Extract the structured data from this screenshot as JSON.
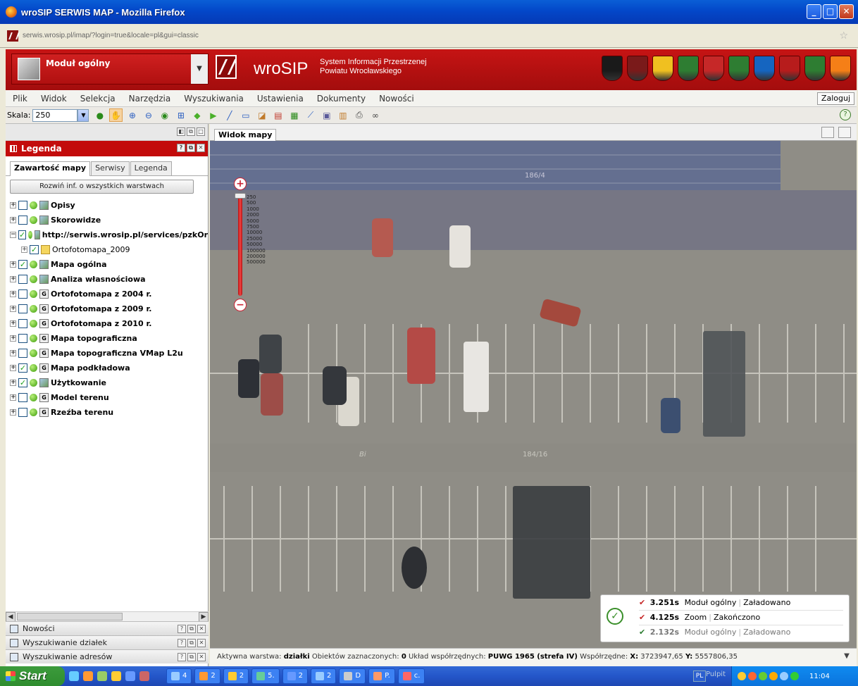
{
  "window": {
    "title": "wroSIP SERWIS MAP - Mozilla Firefox",
    "url": "serwis.wrosip.pl/imap/?login=true&locale=pl&gui=classic"
  },
  "header": {
    "module_label": "Moduł ogólny",
    "brand": "wroSIP",
    "brand_sub_1": "System Informacji Przestrzenej",
    "brand_sub_2": "Powiatu Wrocławskiego",
    "crest_colors": [
      "#1a1a1a",
      "#7a1a1a",
      "#f0c020",
      "#2e7d32",
      "#c62828",
      "#2e7d32",
      "#1565c0",
      "#b71c1c",
      "#2e7d32",
      "#f57f17"
    ]
  },
  "menu": {
    "items": [
      "Plik",
      "Widok",
      "Selekcja",
      "Narzędzia",
      "Wyszukiwania",
      "Ustawienia",
      "Dokumenty",
      "Nowości"
    ],
    "login": "Zaloguj"
  },
  "toolbar": {
    "scale_label": "Skala:",
    "scale_value": "250"
  },
  "legend": {
    "title": "Legenda",
    "tabs": [
      "Zawartość mapy",
      "Serwisy",
      "Legenda"
    ],
    "expand_button": "Rozwiń inf. o wszystkich warstwach",
    "layers": [
      {
        "name": "Opisy",
        "checked": false,
        "icon": "layer",
        "sub": false
      },
      {
        "name": "Skorowidze",
        "checked": false,
        "icon": "layer",
        "sub": false
      },
      {
        "name": "http://serwis.wrosip.pl/services/pzkOr",
        "checked": true,
        "icon": "wms",
        "sub": false
      },
      {
        "name": "Ortofotomapa_2009",
        "checked": true,
        "icon": "folder",
        "sub": true
      },
      {
        "name": "Mapa ogólna",
        "checked": true,
        "icon": "layer",
        "sub": false
      },
      {
        "name": "Analiza własnościowa",
        "checked": false,
        "icon": "layer",
        "sub": false
      },
      {
        "name": "Ortofotomapa z 2004 r.",
        "checked": false,
        "icon": "group",
        "sub": false
      },
      {
        "name": "Ortofotomapa z 2009 r.",
        "checked": false,
        "icon": "group",
        "sub": false
      },
      {
        "name": "Ortofotomapa z 2010 r.",
        "checked": false,
        "icon": "group",
        "sub": false
      },
      {
        "name": "Mapa topograficzna",
        "checked": false,
        "icon": "group",
        "sub": false
      },
      {
        "name": "Mapa topograficzna VMap L2u",
        "checked": false,
        "icon": "group",
        "sub": false
      },
      {
        "name": "Mapa podkładowa",
        "checked": true,
        "icon": "group",
        "sub": false
      },
      {
        "name": "Użytkowanie",
        "checked": true,
        "icon": "layer",
        "sub": false
      },
      {
        "name": "Model terenu",
        "checked": false,
        "icon": "group",
        "sub": false
      },
      {
        "name": "Rzeźba terenu",
        "checked": false,
        "icon": "group",
        "sub": false
      }
    ]
  },
  "accordion": [
    "Nowości",
    "Wyszukiwanie działek",
    "Wyszukiwanie adresów"
  ],
  "map": {
    "tab": "Widok mapy",
    "zoom_scales": [
      "250",
      "500",
      "1000",
      "2000",
      "5000",
      "7500",
      "10000",
      "25000",
      "50000",
      "100000",
      "200000",
      "500000"
    ],
    "parcel_labels": [
      "186/4",
      "184/16",
      "Bi"
    ],
    "messages": [
      {
        "time": "3.251s",
        "module": "Moduł ogólny",
        "status": "Załadowano"
      },
      {
        "time": "4.125s",
        "module": "Zoom",
        "status": "Zakończono"
      },
      {
        "time": "2.132s",
        "module": "Moduł ogólny",
        "status": "Załadowano"
      }
    ]
  },
  "statusbar": {
    "active_layer_label": "Aktywna warstwa:",
    "active_layer": "działki",
    "selected_label": "Obiektów zaznaczonych:",
    "selected": "0",
    "crs_label": "Układ współrzędnych:",
    "crs": "PUWG 1965 (strefa IV)",
    "coords_label": "Współrzędne:",
    "x_label": "X:",
    "x": "3723947,65",
    "y_label": "Y:",
    "y": "5557806,35"
  },
  "taskbar": {
    "start": "Start",
    "tasks": [
      "4",
      "2",
      "2",
      "5.",
      "2",
      "2",
      "D",
      "P.",
      "c."
    ],
    "desktop": "Pulpit",
    "lang": "PL",
    "clock": "11:04"
  }
}
